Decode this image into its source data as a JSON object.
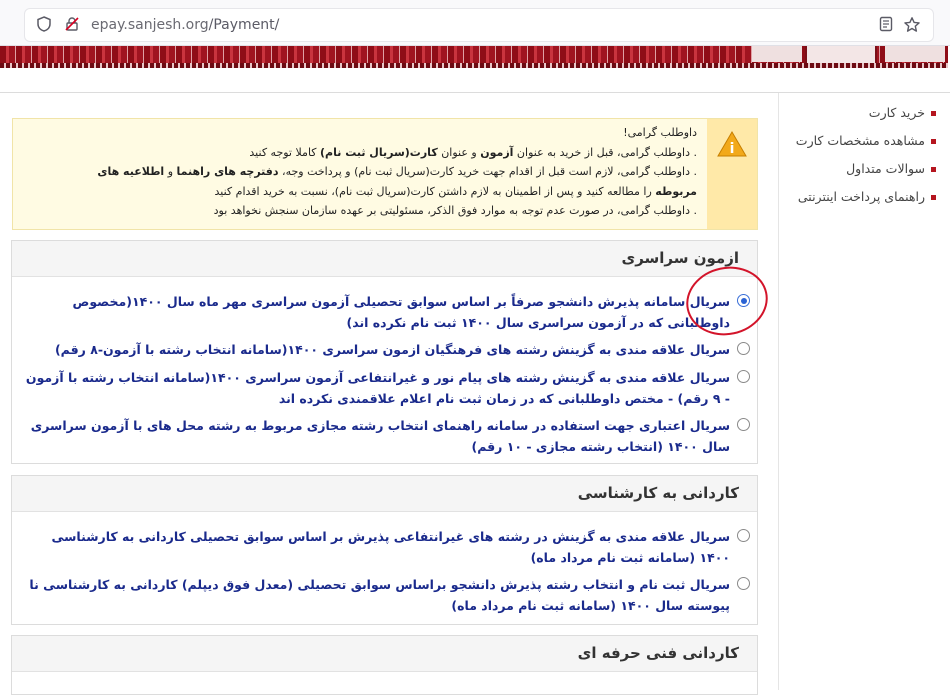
{
  "browser": {
    "url_host": "epay.sanjesh.org",
    "url_path": "/Payment/"
  },
  "sidebar": {
    "items": [
      {
        "label": "خرید کارت"
      },
      {
        "label": "مشاهده مشخصات کارت"
      },
      {
        "label": "سوالات متداول"
      },
      {
        "label": "راهنمای پرداخت اینترنتی"
      }
    ]
  },
  "notice": {
    "greeting": "داوطلب گرامی!",
    "line1_a": "داوطلب گرامی، قبل از خرید به عنوان ",
    "line1_b": "آزمون",
    "line1_c": " و عنوان ",
    "line1_d": "کارت(سریال ثبت نام)",
    "line1_e": " کاملا توجه کنید",
    "line2_a": "داوطلب گرامی، لازم است قبل از اقدام جهت خرید کارت(سریال ثبت نام) و پرداخت وجه، ",
    "line2_b": "دفترچه های راهنما",
    "line2_c": " و ",
    "line2_d": "اطلاعیه های",
    "line3_a": "مربوطه",
    "line3_b": " را مطالعه کنید و پس از اطمینان به لازم داشتن کارت(سریال ثبت نام)، نسبت به خرید اقدام کنید",
    "line4": "داوطلب گرامی، در صورت عدم توجه به موارد فوق الذکر، مسئولیتی بر عهده سازمان سنجش نخواهد بود"
  },
  "sections": [
    {
      "title": "ازمون سراسری",
      "options": [
        {
          "label": "سریال سامانه پذیرش دانشجو صرفاً بر اساس سوابق تحصیلی آزمون سراسری مهر ماه سال ۱۴۰۰(مخصوص داوطلبانی که در آزمون سراسری سال ۱۴۰۰ ثبت نام نکرده اند)",
          "selected": true
        },
        {
          "label": "سریال علاقه مندی به گزینش رشته های فرهنگیان ازمون سراسری ۱۴۰۰(سامانه انتخاب رشته با آزمون-۸ رقم)",
          "selected": false
        },
        {
          "label": "سریال علاقه مندی به گزینش رشته های پیام نور و غیرانتفاعی آزمون سراسری ۱۴۰۰(سامانه انتخاب رشته با آزمون - ۹ رقم) - مختص داوطلبانی که در زمان ثبت نام اعلام علاقمندی نکرده اند",
          "selected": false
        },
        {
          "label": "سریال اعتباری جهت استفاده در سامانه راهنمای انتخاب رشته مجازی مربوط به رشته محل های با آزمون سراسری سال ۱۴۰۰ (انتخاب رشته مجازی - ۱۰ رقم)",
          "selected": false
        }
      ]
    },
    {
      "title": "کاردانی به کارشناسی",
      "options": [
        {
          "label": "سریال علاقه مندی به گزینش در رشته های غیرانتفاعی پذیرش بر اساس سوابق تحصیلی کاردانی به کارشناسی ۱۴۰۰ (سامانه ثبت نام مرداد ماه)",
          "selected": false
        },
        {
          "label": "سریال ثبت نام و انتخاب رشته پذیرش دانشجو براساس سوابق تحصیلی (معدل فوق دیپلم) کاردانی به کارشناسی نا پیوسته سال ۱۴۰۰ (سامانه ثبت نام مرداد ماه)",
          "selected": false
        }
      ]
    },
    {
      "title": "کاردانی فنی حرفه ای",
      "options": []
    }
  ]
}
